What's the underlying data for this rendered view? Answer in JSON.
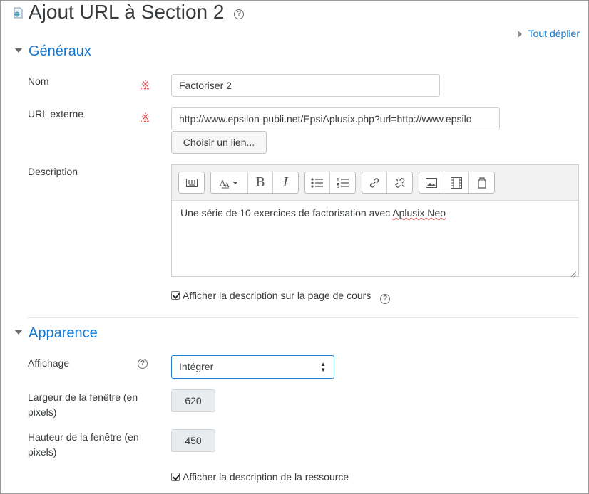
{
  "header": {
    "title": "Ajout URL à Section 2",
    "help_icon": "question-circle-icon",
    "page_icon": "url-resource-icon"
  },
  "expand_all": {
    "label": "Tout déplier"
  },
  "sections": {
    "general": {
      "title": "Généraux",
      "name_label": "Nom",
      "name_value": "Factoriser 2",
      "url_label": "URL externe",
      "url_value": "http://www.epsilon-publi.net/EpsiAplusix.php?url=http://www.epsilo",
      "choose_link_label": "Choisir un lien...",
      "description_label": "Description",
      "description_text_before": "Une série de 10 exercices de factorisation avec ",
      "description_text_spell": "Aplusix Neo",
      "show_description_label": "Afficher la description sur la page de cours"
    },
    "appearance": {
      "title": "Apparence",
      "display_label": "Affichage",
      "display_value": "Intégrer",
      "width_label": "Largeur de la fenêtre (en pixels)",
      "width_value": "620",
      "height_label": "Hauteur de la fenêtre (en pixels)",
      "height_value": "450",
      "show_resource_desc_label": "Afficher la description de la ressource"
    }
  },
  "toolbar": {
    "buttons": [
      "toolbar-toggle-icon",
      "font-style-icon",
      "bold-icon",
      "italic-icon",
      "unordered-list-icon",
      "ordered-list-icon",
      "link-icon",
      "unlink-icon",
      "image-icon",
      "media-icon",
      "file-manager-icon"
    ],
    "bold_label": "B",
    "italic_label": "I"
  },
  "required_marker": "※",
  "colors": {
    "accent": "#1177d1",
    "required": "#d9534f",
    "text": "#373a3c"
  }
}
